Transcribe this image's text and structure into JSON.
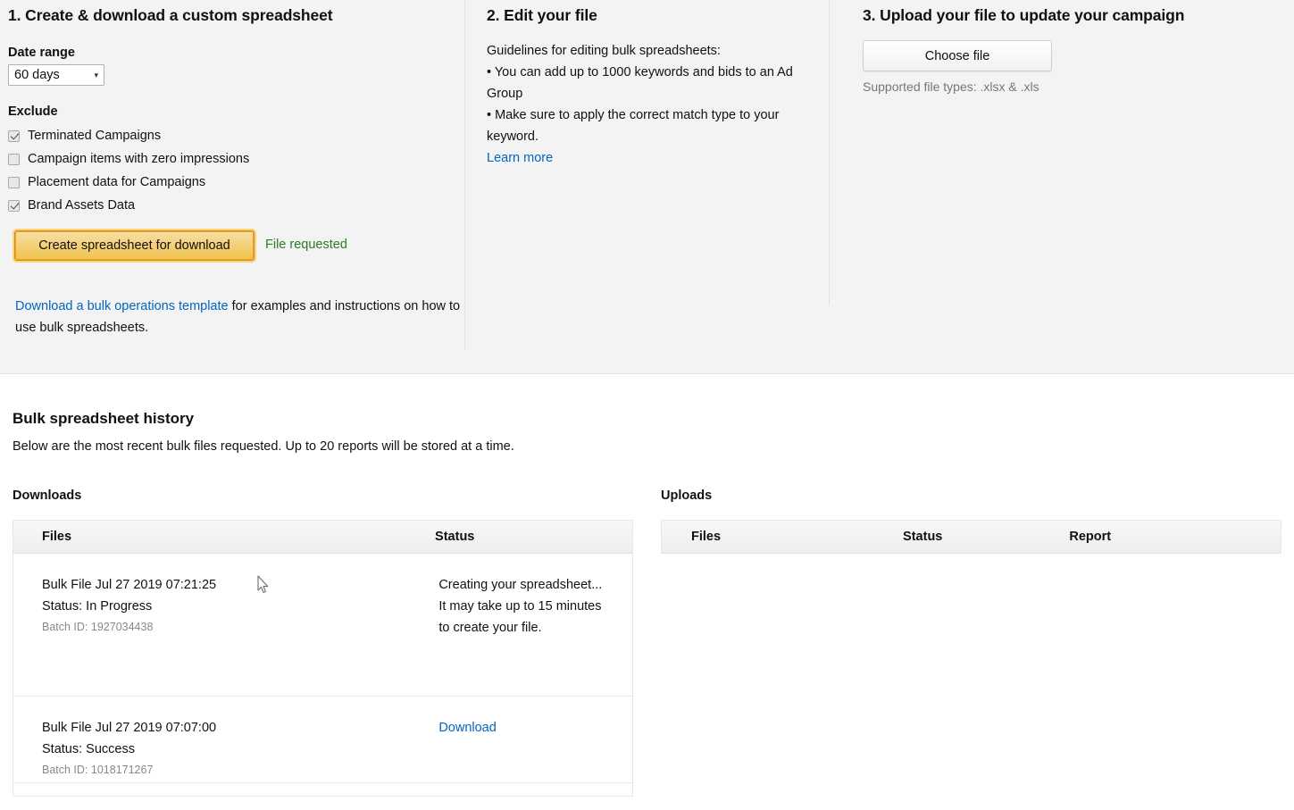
{
  "step1": {
    "title": "1. Create & download a custom spreadsheet",
    "date_range_label": "Date range",
    "date_range_value": "60 days",
    "date_range_caret": "▾",
    "exclude_label": "Exclude",
    "exclude_options": [
      {
        "label": "Terminated Campaigns",
        "checked": true
      },
      {
        "label": "Campaign items with zero impressions",
        "checked": false
      },
      {
        "label": "Placement data for Campaigns",
        "checked": false
      },
      {
        "label": "Brand Assets Data",
        "checked": true
      }
    ],
    "create_button": "Create spreadsheet for download",
    "file_requested": "File requested",
    "template_link": "Download a bulk operations template",
    "template_rest": " for examples and instructions on how to use bulk spreadsheets."
  },
  "step2": {
    "title": "2. Edit your file",
    "intro": "Guidelines for editing bulk spreadsheets:",
    "bullets": [
      "• You can add up to 1000 keywords and bids to an Ad Group",
      "• Make sure to apply the correct match type to your keyword."
    ],
    "learn_more": "Learn more"
  },
  "step3": {
    "title": "3. Upload your file to update your campaign",
    "choose_file": "Choose file",
    "supported": "Supported file types: .xlsx & .xls"
  },
  "history": {
    "title": "Bulk spreadsheet history",
    "subtitle": "Below are the most recent bulk files requested. Up to 20 reports will be stored at a time.",
    "downloads": {
      "label": "Downloads",
      "columns": [
        "Files",
        "Status"
      ],
      "rows": [
        {
          "file": "Bulk File Jul 27 2019 07:21:25",
          "status_line": "Status: In Progress",
          "batch": "Batch ID: 1927034438",
          "status": "Creating your spreadsheet...\nIt may take up to 15 minutes\nto create your file.",
          "status_is_link": false
        },
        {
          "file": "Bulk File Jul 27 2019 07:07:00",
          "status_line": "Status: Success",
          "batch": "Batch ID: 1018171267",
          "status": "Download",
          "status_is_link": true
        }
      ]
    },
    "uploads": {
      "label": "Uploads",
      "columns": [
        "Files",
        "Status",
        "Report"
      ],
      "rows": []
    }
  },
  "colors": {
    "panel_bg": "#f3f3f3",
    "accent_button": "#f0c14b",
    "link": "#0066c0",
    "success_text": "#2a7a2a",
    "muted_text": "#767676"
  }
}
